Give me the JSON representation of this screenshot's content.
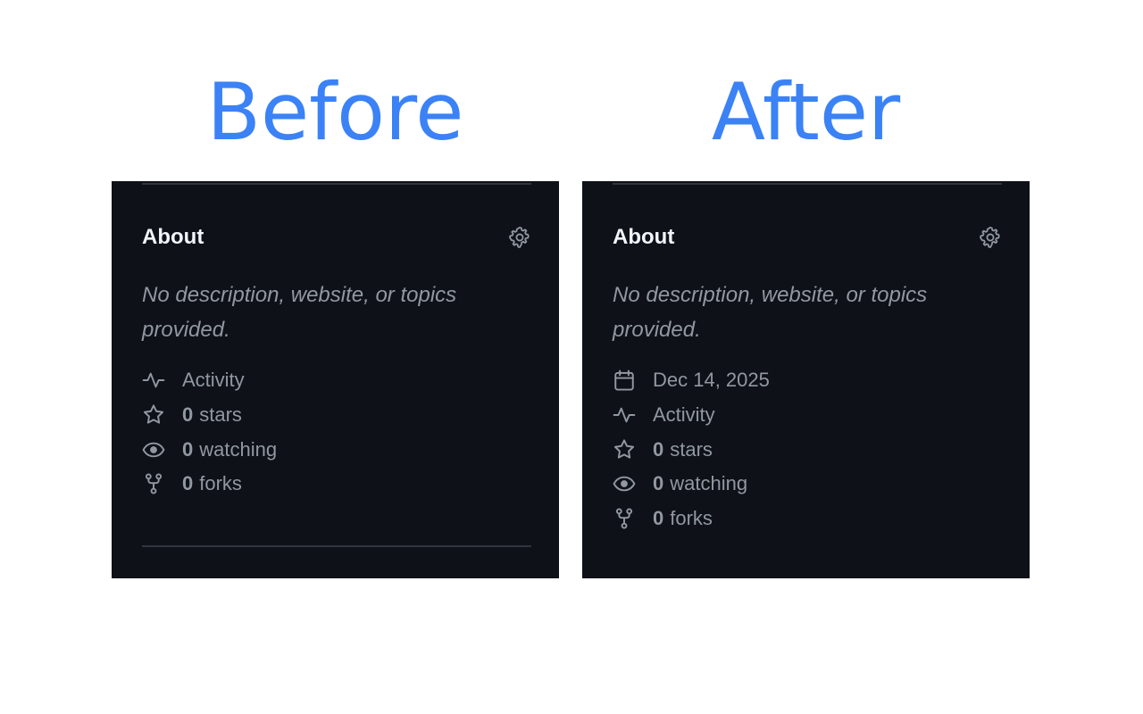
{
  "headings": {
    "before": "Before",
    "after": "After"
  },
  "colors": {
    "heading": "#3b82f6",
    "panel_bg": "#0e1117",
    "title": "#f0f6fc",
    "muted": "#9198a1",
    "divider": "#30363d"
  },
  "before": {
    "about_title": "About",
    "settings_icon": "gear-icon",
    "description": "No description, website, or topics provided.",
    "items": [
      {
        "icon": "pulse-icon",
        "count": "",
        "label": "Activity"
      },
      {
        "icon": "star-icon",
        "count": "0",
        "label": "stars"
      },
      {
        "icon": "eye-icon",
        "count": "0",
        "label": "watching"
      },
      {
        "icon": "fork-icon",
        "count": "0",
        "label": "forks"
      }
    ]
  },
  "after": {
    "about_title": "About",
    "settings_icon": "gear-icon",
    "description": "No description, website, or topics provided.",
    "date_item": {
      "icon": "calendar-icon",
      "label": "Dec 14, 2025"
    },
    "items": [
      {
        "icon": "pulse-icon",
        "count": "",
        "label": "Activity"
      },
      {
        "icon": "star-icon",
        "count": "0",
        "label": "stars"
      },
      {
        "icon": "eye-icon",
        "count": "0",
        "label": "watching"
      },
      {
        "icon": "fork-icon",
        "count": "0",
        "label": "forks"
      }
    ]
  }
}
